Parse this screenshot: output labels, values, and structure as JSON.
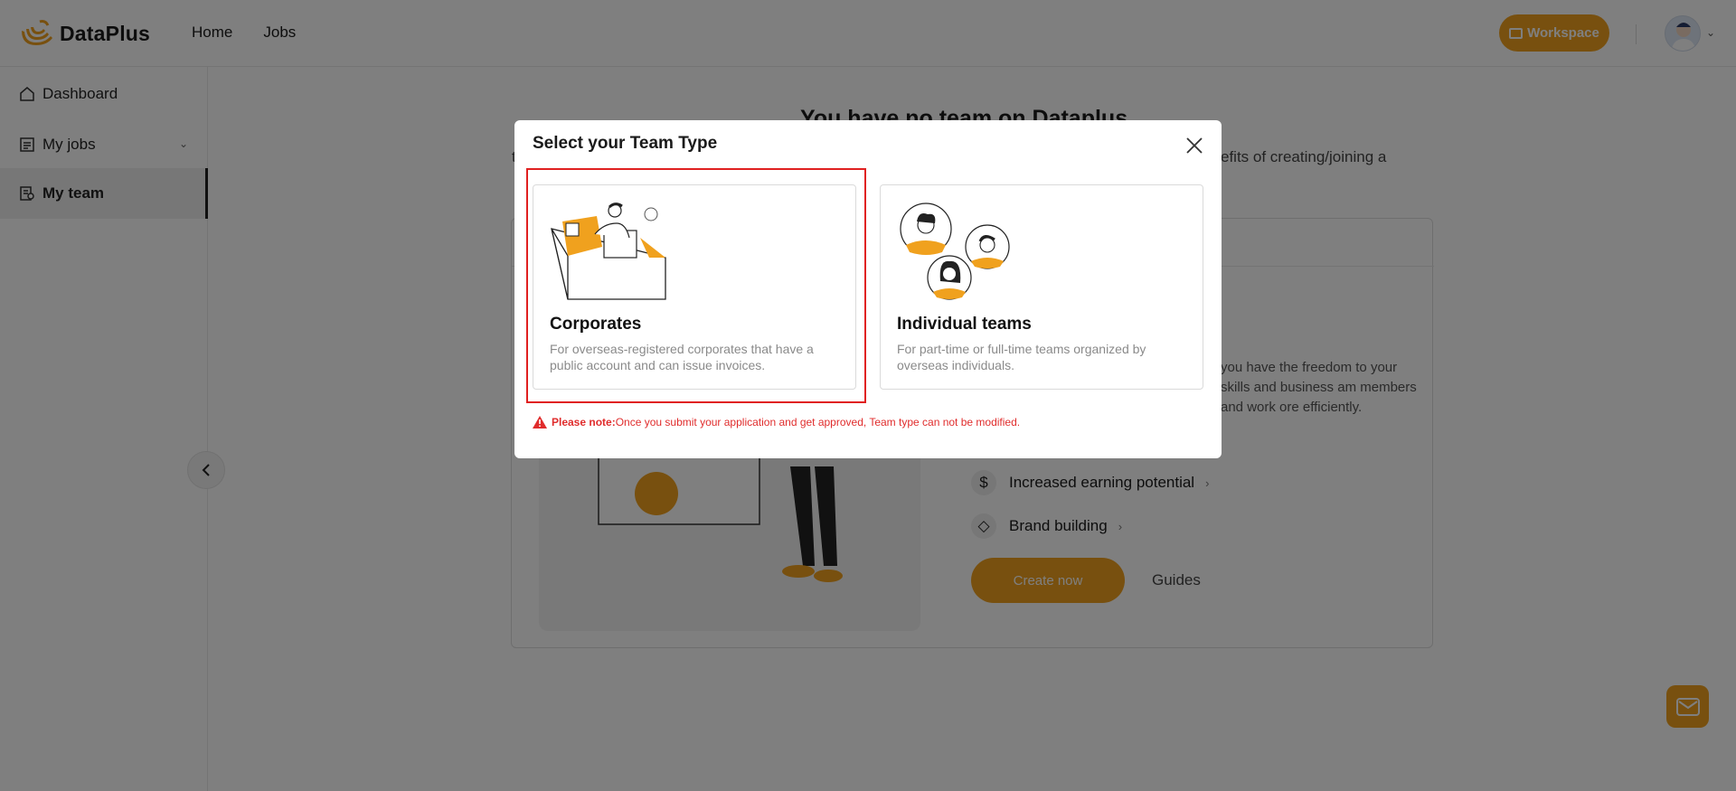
{
  "header": {
    "brand": "DataPlus",
    "nav": [
      {
        "label": "Home"
      },
      {
        "label": "Jobs"
      }
    ],
    "workspace_label": "Workspace",
    "icons": {
      "logo": "dataplus-logo",
      "workspace": "workspace-icon",
      "avatar": "user-avatar",
      "caret": "chevron-down-icon"
    }
  },
  "sidebar": {
    "items": [
      {
        "label": "Dashboard",
        "icon": "home-icon"
      },
      {
        "label": "My jobs",
        "icon": "calendar-icon"
      },
      {
        "label": "My team",
        "icon": "team-doc-icon",
        "active": true
      }
    ]
  },
  "main": {
    "title": "You have no team on Dataplus",
    "subtitle": "efits of creating/joining a",
    "benefit_desc": "you have the freedom to your skills and business am members and work ore efficiently.",
    "benefits": [
      {
        "label": "Increased earning potential",
        "icon": "dollar-icon"
      },
      {
        "label": "Brand building",
        "icon": "diamond-icon"
      }
    ],
    "create_label": "Create now",
    "guides_label": "Guides"
  },
  "modal": {
    "title": "Select your Team Type",
    "cards": [
      {
        "title": "Corporates",
        "desc": "For overseas-registered corporates that have a public account and can issue invoices.",
        "selected": true
      },
      {
        "title": "Individual teams",
        "desc": "For part-time or full-time teams organized by overseas individuals."
      }
    ],
    "note_label": "Please note:",
    "note_text": "Once you submit your application and get approved, Team type can not be modified."
  },
  "colors": {
    "accent": "#f0a11e",
    "highlight": "#e02020",
    "note": "#e02c2c"
  }
}
